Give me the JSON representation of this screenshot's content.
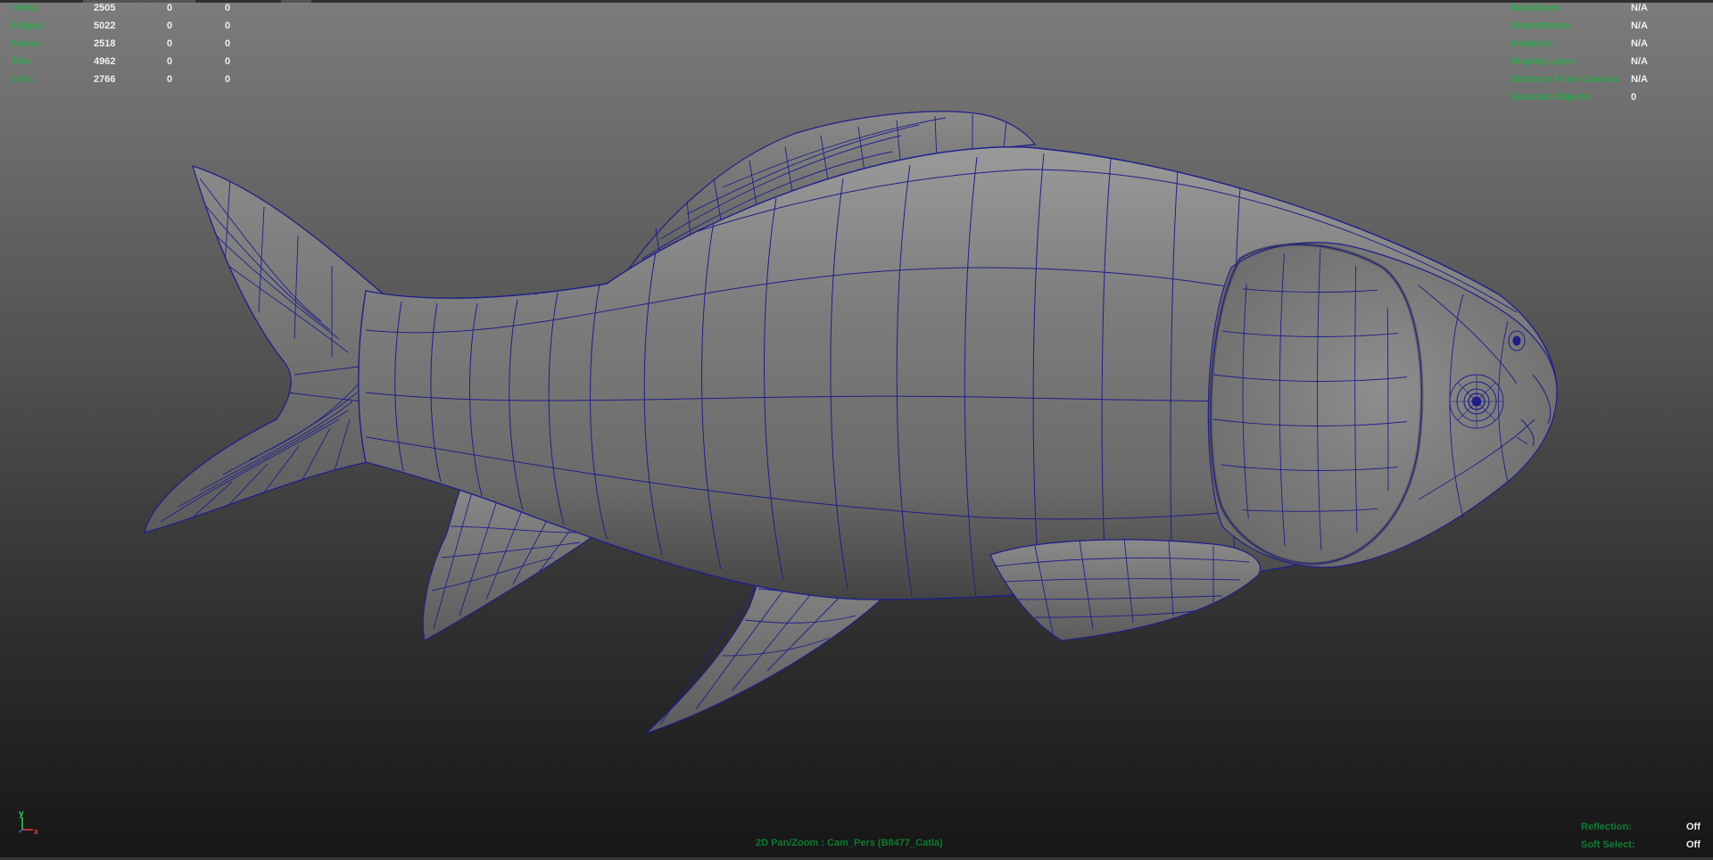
{
  "hud": {
    "poly_count": [
      {
        "label": "Verts:",
        "v1": "2505",
        "v2": "0",
        "v3": "0"
      },
      {
        "label": "Edges:",
        "v1": "5022",
        "v2": "0",
        "v3": "0"
      },
      {
        "label": "Faces:",
        "v1": "2518",
        "v2": "0",
        "v3": "0"
      },
      {
        "label": "Tris:",
        "v1": "4962",
        "v2": "0",
        "v3": "0"
      },
      {
        "label": "UVs:",
        "v1": "2766",
        "v2": "0",
        "v3": "0"
      }
    ],
    "object_details": [
      {
        "label": "Backfaces:",
        "value": "N/A"
      },
      {
        "label": "Smoothness:",
        "value": "N/A"
      },
      {
        "label": "Instance:",
        "value": "N/A"
      },
      {
        "label": "Display Layer:",
        "value": "N/A"
      },
      {
        "label": "Distance From Camera:",
        "value": "N/A"
      },
      {
        "label": "Selected Objects:",
        "value": "0"
      }
    ],
    "viewport_status": [
      {
        "label": "Reflection:",
        "value": "Off"
      },
      {
        "label": "Soft Select:",
        "value": "Off"
      }
    ],
    "camera_label": "2D Pan/Zoom : Cam_Pers (B8477_Catla)"
  },
  "axis": {
    "y": "y",
    "x": "x"
  },
  "colors": {
    "wireframe": "#1f1f8a",
    "hud_label": "#2aa84a",
    "hud_value": "#f0f0f0",
    "axis_y": "#2fd24f",
    "axis_x": "#e23b3b",
    "axis_z": "#3b5fe2"
  }
}
